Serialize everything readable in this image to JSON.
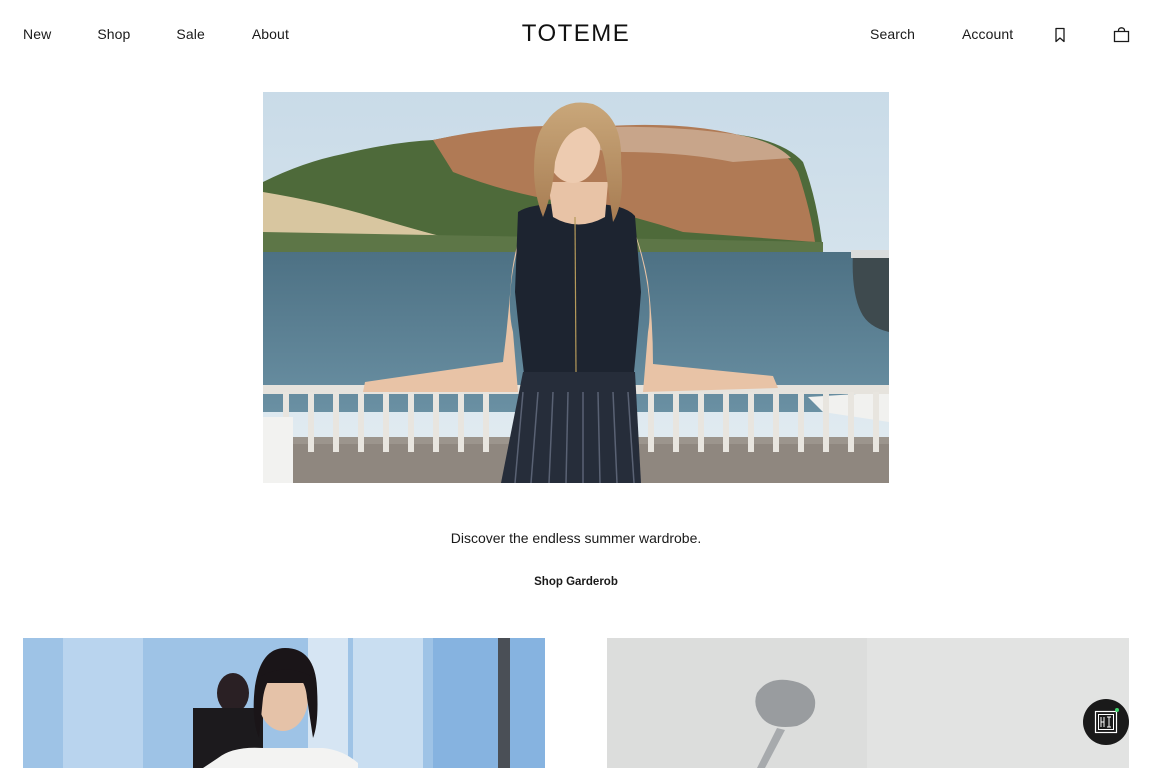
{
  "header": {
    "nav_left": [
      "New",
      "Shop",
      "Sale",
      "About"
    ],
    "logo": "TOTEME",
    "nav_right": [
      "Search",
      "Account"
    ],
    "icons": [
      "bookmark-icon",
      "shopping-bag-icon"
    ]
  },
  "hero": {
    "media": "video-still-woman-by-sea-railing",
    "caption": "Discover the endless summer wardrobe.",
    "cta_label": "Shop Garderob"
  },
  "tiles": [
    {
      "media": "model-portrait-runway"
    },
    {
      "media": "abstract-grey-shadow"
    }
  ],
  "chat_widget": {
    "icon": "chat-logo-icon",
    "status_color": "#3ed46a"
  },
  "colors": {
    "text": "#1a1a1a",
    "background": "#ffffff"
  }
}
